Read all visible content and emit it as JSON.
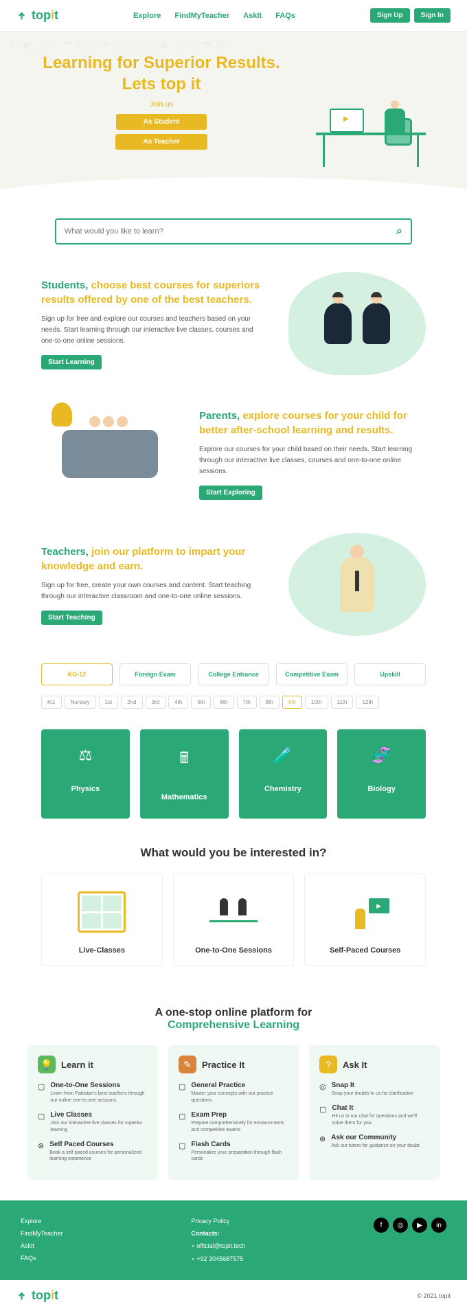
{
  "brand": "topit",
  "nav": {
    "explore": "Explore",
    "findteacher": "FindMyTeacher",
    "askit": "AskIt",
    "faqs": "FAQs"
  },
  "auth": {
    "signup": "Sign Up",
    "signin": "Sign In"
  },
  "hero": {
    "title": "Learning for Superior Results. Lets top it",
    "join": "Join us",
    "student": "As Student",
    "teacher": "As Teacher"
  },
  "search": {
    "placeholder": "What would you like to learn?"
  },
  "students": {
    "title_g": "Students, ",
    "title_y": "choose best courses for superiors results offered by one of the best teachers.",
    "body": "Sign up for free and explore our courses and teachers based on your needs. Start learning through our interactive live classes, courses and one-to-one online sessions.",
    "btn": "Start Learning"
  },
  "parents": {
    "title_g": "Parents, ",
    "title_y": "explore courses for your child for better after-school learning and results.",
    "body": "Explore our courses for your child based on their needs. Start learning through our interactive live classes, courses and one-to-one online sessions.",
    "btn": "Start Exploring"
  },
  "teachers": {
    "title_g": "Teachers, ",
    "title_y": "join our platform to impart your knowledge and earn.",
    "body": "Sign up for free, create your own courses and content. Start teaching through our interactive classroom and one-to-one online sessions.",
    "btn": "Start Teaching"
  },
  "tabs": [
    "KG-12",
    "Foreign Exam",
    "College Entrance",
    "Competitive Exam",
    "Upskill"
  ],
  "tabs_active": 0,
  "grades": [
    "KG",
    "Nursery",
    "1st",
    "2nd",
    "3rd",
    "4th",
    "5th",
    "6th",
    "7th",
    "8th",
    "9th",
    "10th",
    "11th",
    "12th"
  ],
  "grades_active": 10,
  "subjects": [
    {
      "icon": "⚖",
      "name": "Physics"
    },
    {
      "icon": "🖩",
      "name": "Mathematics"
    },
    {
      "icon": "🧪",
      "name": "Chemistry"
    },
    {
      "icon": "🧬",
      "name": "Biology"
    }
  ],
  "interest": {
    "title": "What would you be interested in?",
    "items": [
      "Live-Classes",
      "One-to-One Sessions",
      "Self-Paced Courses"
    ]
  },
  "platform": {
    "title": "A one-stop online platform for",
    "subtitle": "Comprehensive Learning",
    "cards": [
      {
        "icon": "💡",
        "color": "g",
        "title": "Learn it",
        "items": [
          {
            "icon": "▢",
            "h": "One-to-One Sessions",
            "p": "Learn from Pakistan's best teachers through our online one-to-one sessions"
          },
          {
            "icon": "▢",
            "h": "Live Classes",
            "p": "Join our interactive live classes for superior learning"
          },
          {
            "icon": "⊛",
            "h": "Self Paced Courses",
            "p": "Book a self paced courses for personalized learning experience"
          }
        ]
      },
      {
        "icon": "✎",
        "color": "o",
        "title": "Practice It",
        "items": [
          {
            "icon": "▢",
            "h": "General Practice",
            "p": "Master your concepts with our practice questions"
          },
          {
            "icon": "▢",
            "h": "Exam Prep",
            "p": "Prepare comprehensively for entrance tests and competitive exams"
          },
          {
            "icon": "▢",
            "h": "Flash Cards",
            "p": "Personalize your preparation through flash cards"
          }
        ]
      },
      {
        "icon": "?",
        "color": "y",
        "title": "Ask It",
        "items": [
          {
            "icon": "◎",
            "h": "Snap It",
            "p": "Snap your doubts to us for clarification"
          },
          {
            "icon": "▢",
            "h": "Chat It",
            "p": "Hit us in our chat for questions and we'll solve them for you"
          },
          {
            "icon": "⊛",
            "h": "Ask our Community",
            "p": "Ask our tutors for guidance on your doubt"
          }
        ]
      }
    ]
  },
  "footer": {
    "links": [
      "Explore",
      "FindMyTeacher",
      "AskIt",
      "FAQs"
    ],
    "privacy": "Privacy Policy",
    "contacts": "Contacts:",
    "email": "official@topit.tech",
    "phone": "+92 3045687575"
  },
  "copy": "© 2021 topit"
}
